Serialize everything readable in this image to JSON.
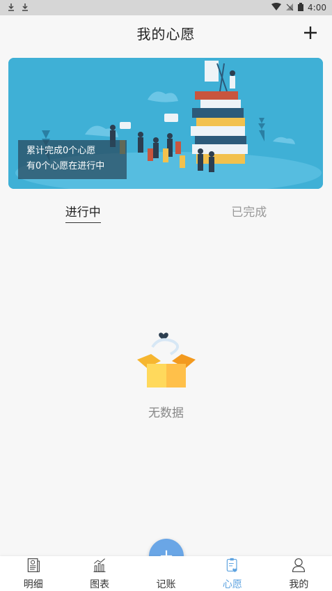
{
  "status_bar": {
    "time": "4:00"
  },
  "header": {
    "title": "我的心愿",
    "add_label": "+"
  },
  "banner": {
    "line1": "累计完成0个心愿",
    "line2": "有0个心愿在进行中"
  },
  "tabs": [
    {
      "label": "进行中",
      "active": true
    },
    {
      "label": "已完成",
      "active": false
    }
  ],
  "empty": {
    "text": "无数据"
  },
  "bottom_nav": {
    "items": [
      {
        "label": "明细",
        "icon": "receipt-icon"
      },
      {
        "label": "图表",
        "icon": "chart-icon"
      },
      {
        "label": "记账",
        "icon": "plus-icon"
      },
      {
        "label": "心愿",
        "icon": "wish-icon",
        "active": true
      },
      {
        "label": "我的",
        "icon": "user-icon"
      }
    ],
    "fab_symbol": "+"
  },
  "colors": {
    "accent": "#6aa6e6",
    "banner_bg": "#3fb0d6",
    "active_nav": "#5ea3e0"
  }
}
